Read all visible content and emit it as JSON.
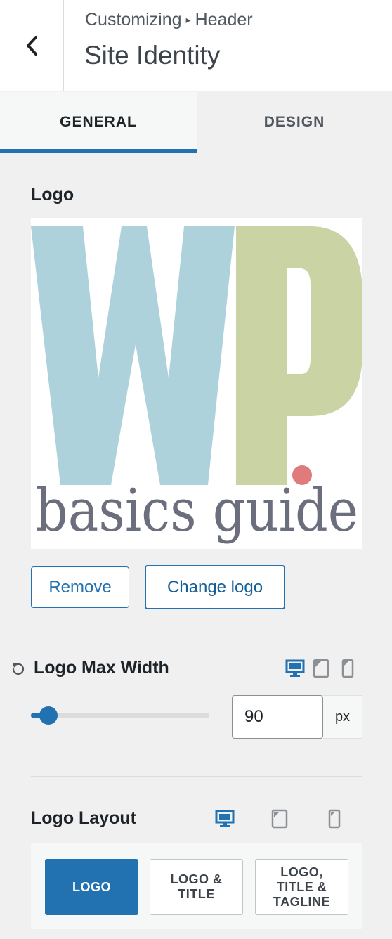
{
  "header": {
    "breadcrumb_parent": "Customizing",
    "breadcrumb_separator": "▸",
    "breadcrumb_child": "Header",
    "title": "Site Identity"
  },
  "tabs": [
    {
      "label": "GENERAL",
      "active": true
    },
    {
      "label": "DESIGN",
      "active": false
    }
  ],
  "logo": {
    "label": "Logo",
    "image_text_large_1": "W",
    "image_text_large_2": "P",
    "image_text_bottom": "basics guide",
    "remove_label": "Remove",
    "change_label": "Change logo"
  },
  "max_width": {
    "label": "Logo Max Width",
    "value": "90",
    "unit": "px",
    "slider_fraction": 0.1
  },
  "layout": {
    "label": "Logo Layout",
    "options": [
      {
        "label": "LOGO",
        "active": true
      },
      {
        "label": "LOGO &\nTITLE",
        "active": false
      },
      {
        "label": "LOGO,\nTITLE &\nTAGLINE",
        "active": false
      }
    ]
  },
  "colors": {
    "accent": "#2271b1",
    "logo_blue": "#aed2dc",
    "logo_green": "#c9d3a4",
    "logo_dot": "#e07b7b",
    "logo_text": "#6b6e7c"
  },
  "icons": {
    "back": "chevron-left-icon",
    "reset": "undo-icon",
    "desktop": "desktop-icon",
    "tablet": "tablet-icon",
    "mobile": "mobile-icon"
  }
}
